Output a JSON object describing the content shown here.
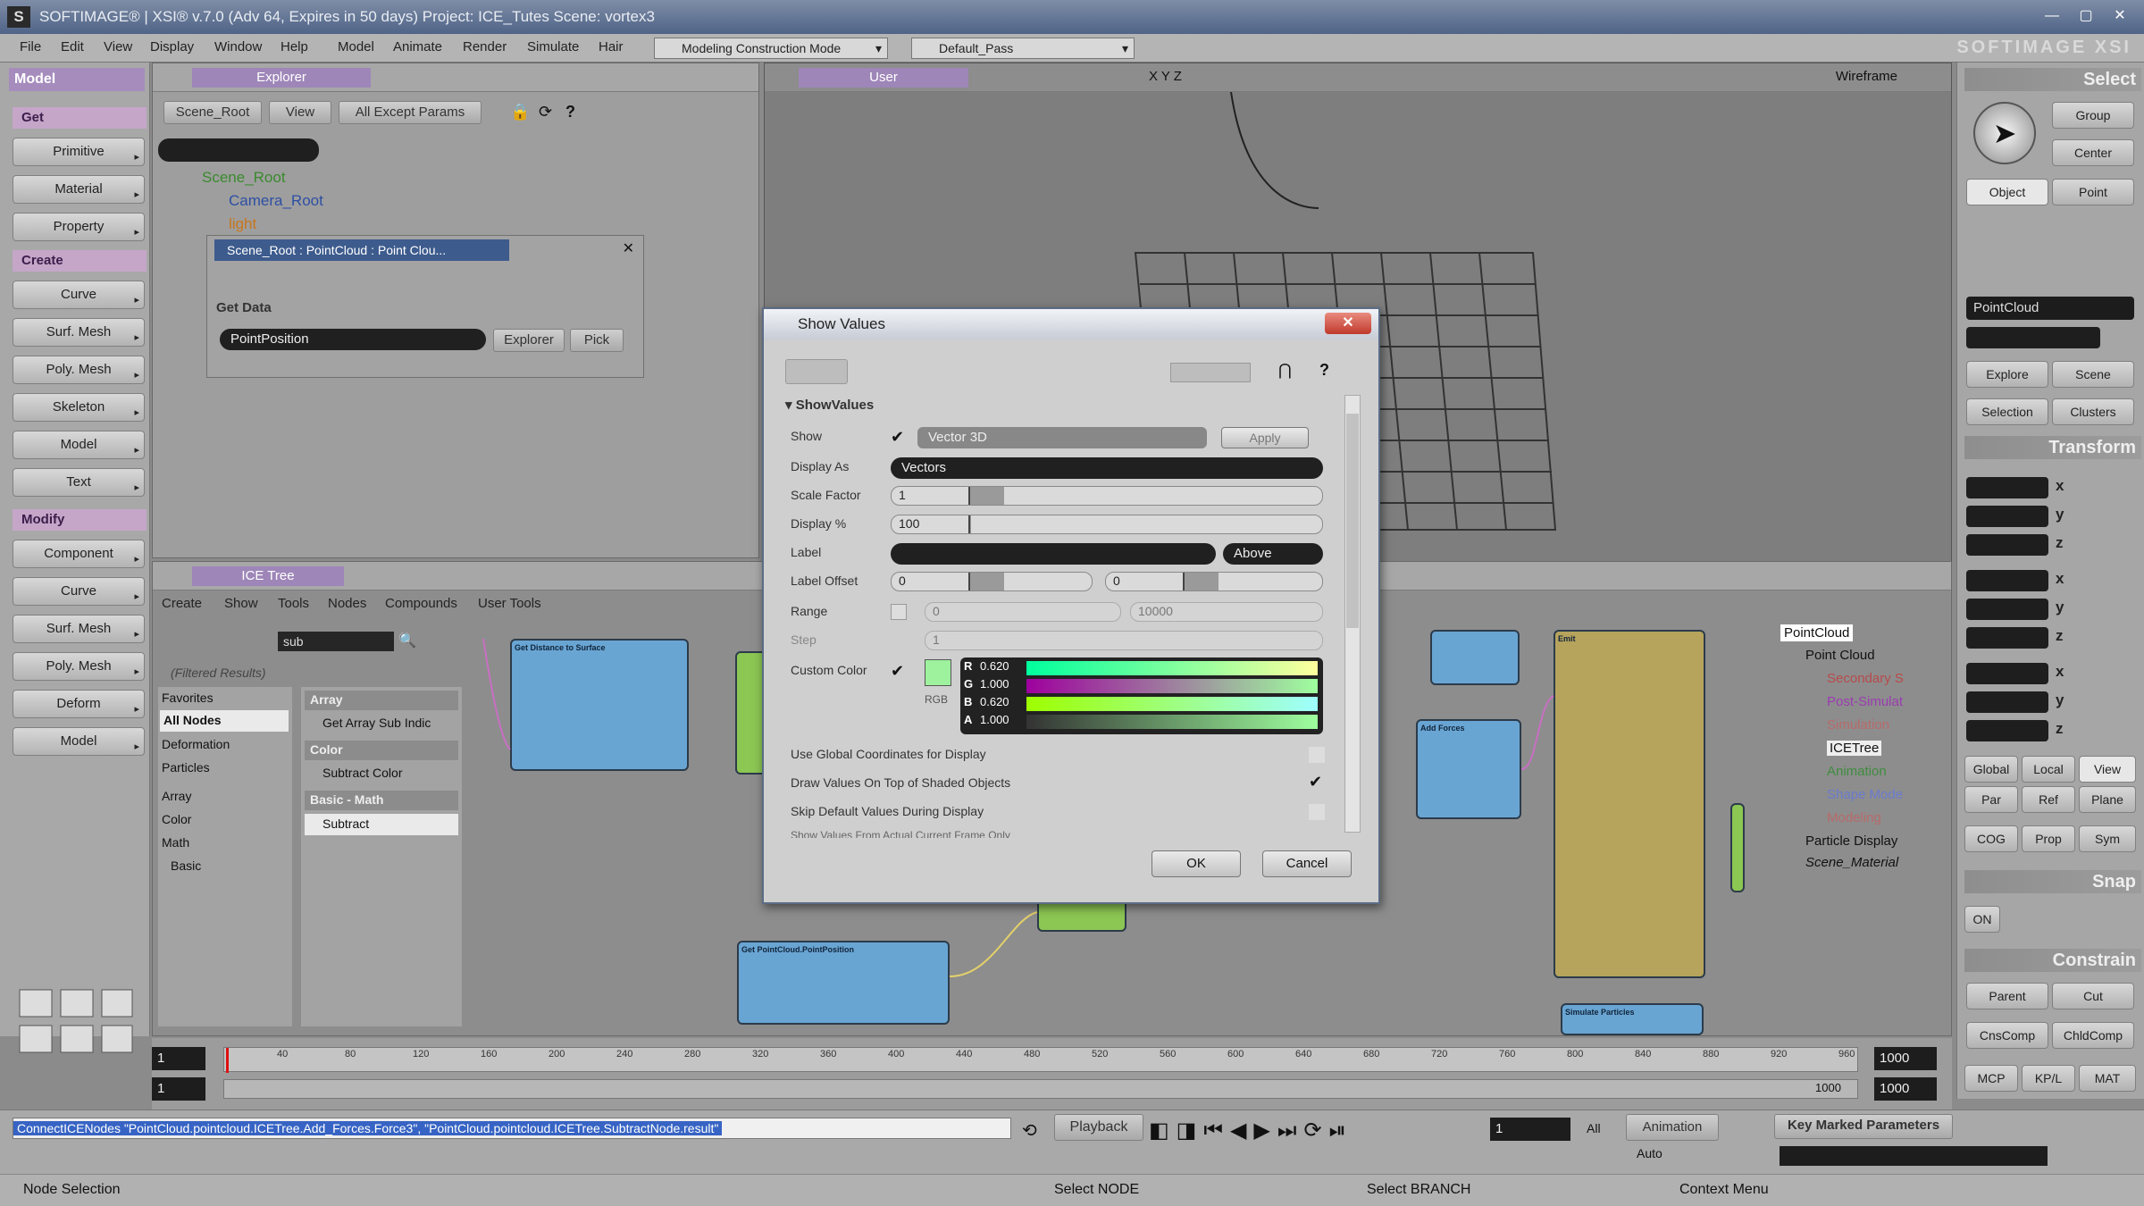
{
  "titlebar": {
    "text": "SOFTIMAGE® | XSI® v.7.0 (Adv 64, Expires in 50 days) Project: ICE_Tutes    Scene: vortex3"
  },
  "menu": {
    "items": [
      "File",
      "Edit",
      "View",
      "Display",
      "Window",
      "Help",
      "Model",
      "Animate",
      "Render",
      "Simulate",
      "Hair"
    ],
    "mode": "Modeling Construction Mode",
    "pass": "Default_Pass",
    "brand": "SOFTIMAGE XSI"
  },
  "leftpanel": {
    "model": "Model",
    "get": "Get",
    "get_items": [
      "Primitive",
      "Material",
      "Property"
    ],
    "create": "Create",
    "create_items": [
      "Curve",
      "Surf. Mesh",
      "Poly. Mesh",
      "Skeleton",
      "Model",
      "Text"
    ],
    "modify": "Modify",
    "modify_items": [
      "Component",
      "Curve",
      "Surf. Mesh",
      "Poly. Mesh",
      "Deform",
      "Model"
    ]
  },
  "explorer": {
    "title": "Explorer",
    "scope": "Scene_Root",
    "view": "View",
    "filter": "All Except Params",
    "tree": [
      "Scene_Root",
      "Camera_Root",
      "light"
    ],
    "getdata": {
      "title": "Scene_Root : PointCloud : Point Clou...",
      "section": "Get Data",
      "value": "PointPosition",
      "explorer_btn": "Explorer",
      "pick_btn": "Pick"
    }
  },
  "viewport": {
    "camera": "User",
    "mode": "Wireframe",
    "axes": "X Y Z"
  },
  "icetree": {
    "title": "ICE Tree",
    "menu": [
      "Create",
      "Show",
      "Tools",
      "Nodes",
      "Compounds",
      "User Tools"
    ],
    "search": "sub",
    "filtered": "(Filtered Results)",
    "categories": [
      "Favorites",
      "All Nodes",
      "Deformation",
      "Particles",
      "Array",
      "Color",
      "Math",
      "Basic"
    ],
    "results": {
      "array_hdr": "Array",
      "array_item": "Get Array Sub Indic",
      "color_hdr": "Color",
      "color_item": "Subtract Color",
      "math_hdr": "Basic - Math",
      "math_item": "Subtract"
    },
    "nodes": {
      "dist": "Get Distance to Surface",
      "getpos": "Get PointCloud.PointPosition",
      "addforces": "Add Forces",
      "simulate": "Simulate Particles",
      "emit": "Emit"
    },
    "scenetree": [
      "PointCloud",
      "Point Cloud",
      "Secondary S",
      "Post-Simulat",
      "Simulation",
      "ICETree",
      "Animation",
      "Shape Mode",
      "Modeling",
      "Particle Display",
      "Scene_Material"
    ]
  },
  "dialog": {
    "title": "Show Values",
    "section": "ShowValues",
    "show_label": "Show",
    "show_value": "Vector 3D",
    "apply": "Apply",
    "displayas_label": "Display As",
    "displayas_value": "Vectors",
    "scale_label": "Scale Factor",
    "scale_value": "1",
    "displaypct_label": "Display %",
    "displaypct_value": "100",
    "label_label": "Label",
    "label_pos": "Above",
    "offset_label": "Label Offset",
    "offset_x": "0",
    "offset_y": "0",
    "range_label": "Range",
    "range_min": "0",
    "range_max": "10000",
    "step_label": "Step",
    "step_value": "1",
    "color_label": "Custom Color",
    "rgb_label": "RGB",
    "r": "0.620",
    "g": "1.000",
    "b": "0.620",
    "a": "1.000",
    "opt1": "Use Global Coordinates for Display",
    "opt2": "Draw Values On Top of Shaded Objects",
    "opt3": "Skip Default Values During Display",
    "opt4": "Show Values From Actual Current Frame Only",
    "ok": "OK",
    "cancel": "Cancel",
    "swatch": "#9ef29e"
  },
  "rightpanel": {
    "select": "Select",
    "group": "Group",
    "center": "Center",
    "object": "Object",
    "point": "Point",
    "selected": "PointCloud",
    "explore": "Explore",
    "scene": "Scene",
    "selection": "Selection",
    "clusters": "Clusters",
    "transform": "Transform",
    "global": "Global",
    "local": "Local",
    "view": "View",
    "par": "Par",
    "ref": "Ref",
    "plane": "Plane",
    "cog": "COG",
    "prop": "Prop",
    "sym": "Sym",
    "snap": "Snap",
    "on": "ON",
    "constrain": "Constrain",
    "parent": "Parent",
    "cut": "Cut",
    "cnscomp": "CnsComp",
    "chldcomp": "ChldComp",
    "mcp": "MCP",
    "kpl": "KP/L",
    "mat": "MAT"
  },
  "timeline": {
    "start": "1",
    "end": "1000",
    "current": "1",
    "ticks": [
      "40",
      "80",
      "120",
      "160",
      "200",
      "240",
      "280",
      "320",
      "360",
      "400",
      "440",
      "480",
      "520",
      "560",
      "600",
      "640",
      "680",
      "720",
      "760",
      "800",
      "840",
      "880",
      "920",
      "960"
    ],
    "end2": "1000",
    "range_end": "1000"
  },
  "bottom": {
    "command": "ConnectICENodes \"PointCloud.pointcloud.ICETree.Add_Forces.Force3\", \"PointCloud.pointcloud.ICETree.SubtractNode.result\"",
    "playback": "Playback",
    "frame": "1",
    "all": "All",
    "animation": "Animation",
    "auto": "Auto",
    "keymarked": "Key Marked Parameters"
  },
  "status": {
    "left": "Node Selection",
    "mid1": "Select NODE",
    "mid2": "Select BRANCH",
    "mid3": "Context Menu"
  }
}
